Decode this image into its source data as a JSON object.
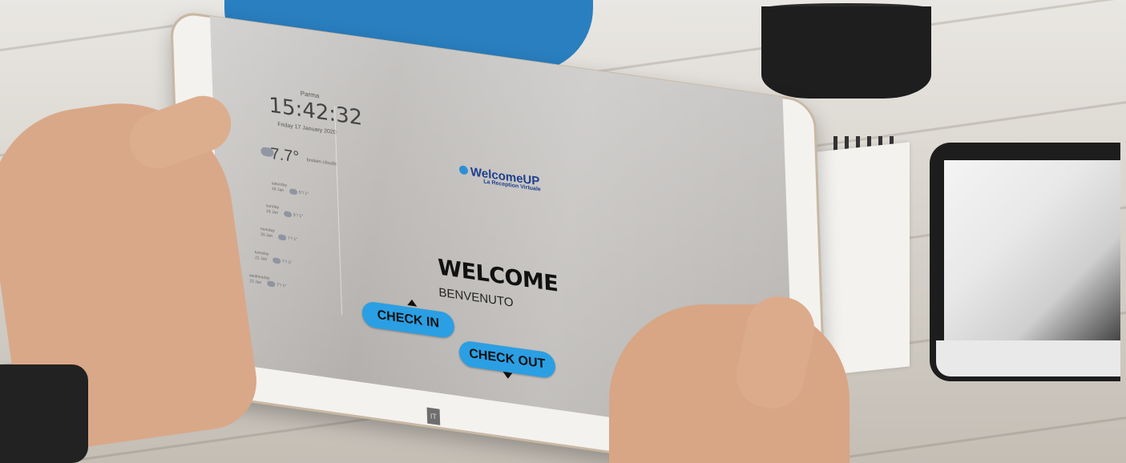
{
  "screen": {
    "sidebar": {
      "city": "Parma",
      "time": "15:42:32",
      "date": "Friday 17 January 2020",
      "temperature": "7.7°",
      "weather_desc": "broken clouds",
      "forecast": [
        {
          "day": "saturday",
          "date": "18 Jan",
          "temp": "5°/ 1°"
        },
        {
          "day": "sunday",
          "date": "19 Jan",
          "temp": "5°/ 1°"
        },
        {
          "day": "monday",
          "date": "20 Jan",
          "temp": "7°/ 1°"
        },
        {
          "day": "tuesday",
          "date": "21 Jan",
          "temp": "7°/ 1°"
        },
        {
          "day": "wednesday",
          "date": "22 Jan",
          "temp": "7°/ 1°"
        }
      ]
    },
    "logo": {
      "name": "WelcomeUP",
      "tagline": "La Reception Virtuale"
    },
    "welcome": "WELCOME",
    "benvenuto": "BENVENUTO",
    "check_in": "CHECK IN",
    "check_out": "CHECK OUT",
    "small_button": "IT"
  },
  "colors": {
    "button_blue": "#2b9fe3",
    "logo_blue": "#1d3f8c"
  }
}
